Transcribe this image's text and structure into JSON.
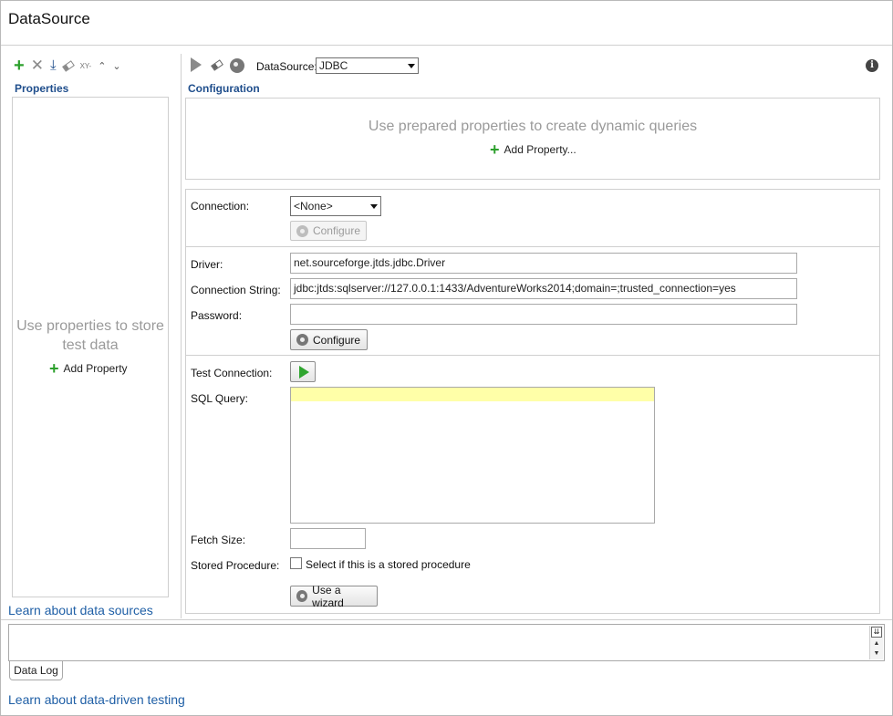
{
  "window": {
    "title": "DataSource"
  },
  "left_toolbar": {
    "icons": [
      "add-icon",
      "delete-icon",
      "download-icon",
      "eraser-icon",
      "xy-icon",
      "move-up-icon",
      "move-down-icon"
    ],
    "xy_label": "XY-"
  },
  "properties": {
    "title": "Properties",
    "empty_text": "Use properties to store test data",
    "add_label": "Add Property",
    "learn_link": "Learn about data sources"
  },
  "right_toolbar": {
    "datasource_label": "DataSource:",
    "datasource_value": "JDBC"
  },
  "configuration": {
    "title": "Configuration",
    "prepared_text": "Use prepared properties to create dynamic queries",
    "add_property_label": "Add Property..."
  },
  "connection": {
    "label": "Connection:",
    "value": "<None>",
    "configure_label": "Configure"
  },
  "driver": {
    "label": "Driver:",
    "value": "net.sourceforge.jtds.jdbc.Driver"
  },
  "connection_string": {
    "label": "Connection String:",
    "value": "jdbc:jtds:sqlserver://127.0.0.1:1433/AdventureWorks2014;domain=;trusted_connection=yes"
  },
  "password": {
    "label": "Password:",
    "value": "",
    "configure_label": "Configure"
  },
  "test_connection": {
    "label": "Test Connection:"
  },
  "sql_query": {
    "label": "SQL Query:",
    "value": ""
  },
  "fetch_size": {
    "label": "Fetch Size:",
    "value": ""
  },
  "stored_procedure": {
    "label": "Stored Procedure:",
    "checkbox_label": "Select if this is a stored procedure",
    "checked": false
  },
  "wizard": {
    "label": "Use a wizard"
  },
  "data_log": {
    "tab_label": "Data Log"
  },
  "footer": {
    "link": "Learn about data-driven testing"
  },
  "colors": {
    "accent": "#1f4e8c",
    "add_green": "#2ca02c",
    "play_green": "#2fa52f",
    "highlight_row": "#ffffa8"
  }
}
